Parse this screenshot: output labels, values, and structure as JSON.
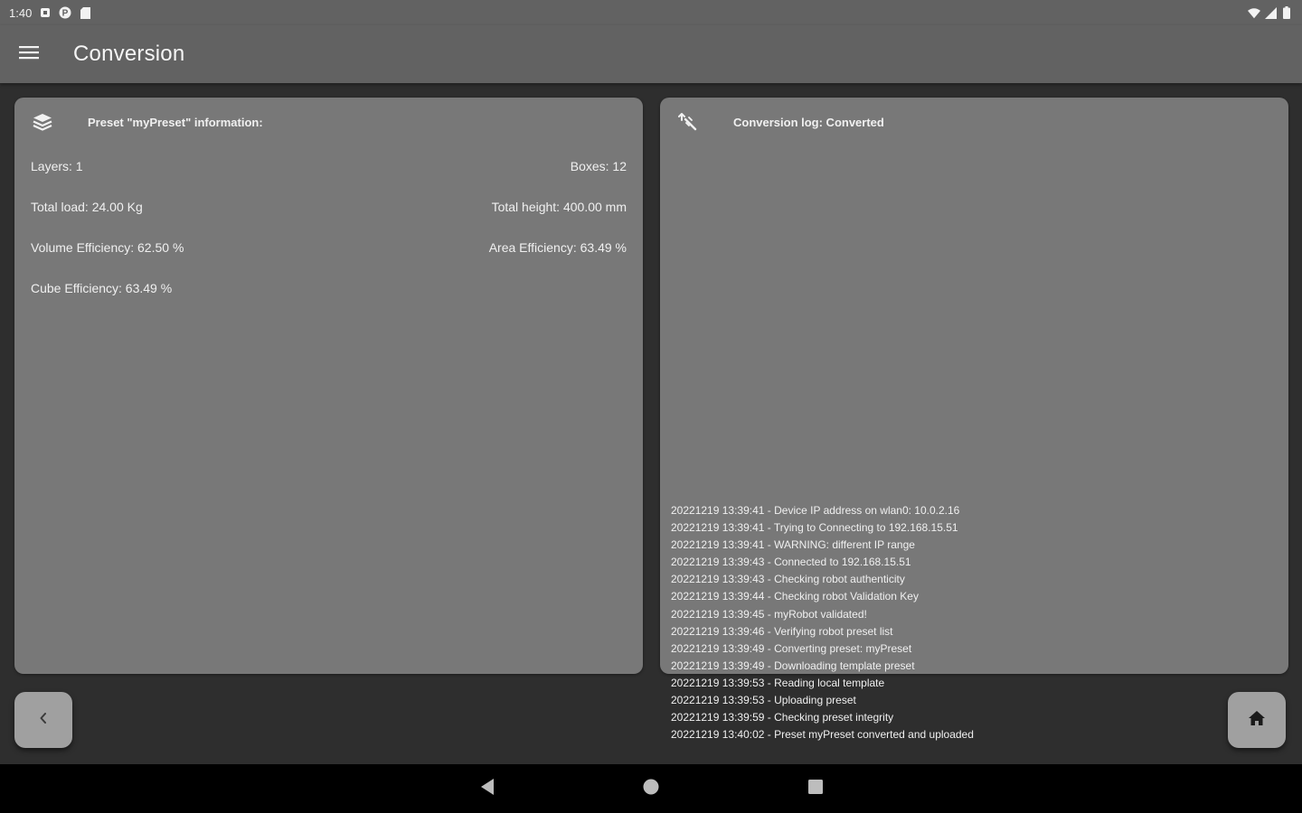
{
  "status_bar": {
    "time": "1:40",
    "icons_left": [
      "notification-icon",
      "app-p-icon",
      "sd-card-icon"
    ],
    "icons_right": [
      "wifi-icon",
      "cell-signal-icon",
      "battery-icon"
    ]
  },
  "app_bar": {
    "title": "Conversion",
    "menu_icon": "hamburger-menu-icon"
  },
  "preset_card": {
    "icon": "layers-icon",
    "title": "Preset \"myPreset\" information:",
    "layers": "Layers: 1",
    "boxes": "Boxes: 12",
    "total_load": "Total load: 24.00 Kg",
    "total_height": "Total height: 400.00 mm",
    "volume_efficiency": "Volume Efficiency: 62.50 %",
    "area_efficiency": "Area Efficiency: 63.49 %",
    "cube_efficiency": "Cube Efficiency: 63.49 %"
  },
  "log_card": {
    "icon": "conversion-icon",
    "title": "Conversion log: Converted",
    "entries": [
      "20221219 13:39:41 - Device IP address on wlan0: 10.0.2.16",
      "20221219 13:39:41 - Trying to Connecting to 192.168.15.51",
      "20221219 13:39:41 - WARNING: different IP range",
      "20221219 13:39:43 - Connected to 192.168.15.51",
      "20221219 13:39:43 - Checking robot authenticity",
      "20221219 13:39:44 - Checking robot Validation Key",
      "20221219 13:39:45 - myRobot validated!",
      "20221219 13:39:46 - Verifying robot preset list",
      "20221219 13:39:49 - Converting preset: myPreset",
      "20221219 13:39:49 - Downloading template preset",
      "20221219 13:39:53 - Reading local template",
      "20221219 13:39:53 - Uploading preset",
      "20221219 13:39:59 - Checking preset integrity",
      "20221219 13:40:02 - Preset myPreset converted and uploaded"
    ]
  },
  "buttons": {
    "back_icon": "chevron-left-icon",
    "home_icon": "home-icon"
  },
  "nav_bar": {
    "back_icon": "nav-back-icon",
    "home_icon": "nav-home-icon",
    "recents_icon": "nav-recents-icon"
  },
  "colors": {
    "background": "#2e2e2e",
    "bars": "#626262",
    "card": "#787878",
    "fab": "#a0a0a0",
    "nav": "#000000"
  }
}
